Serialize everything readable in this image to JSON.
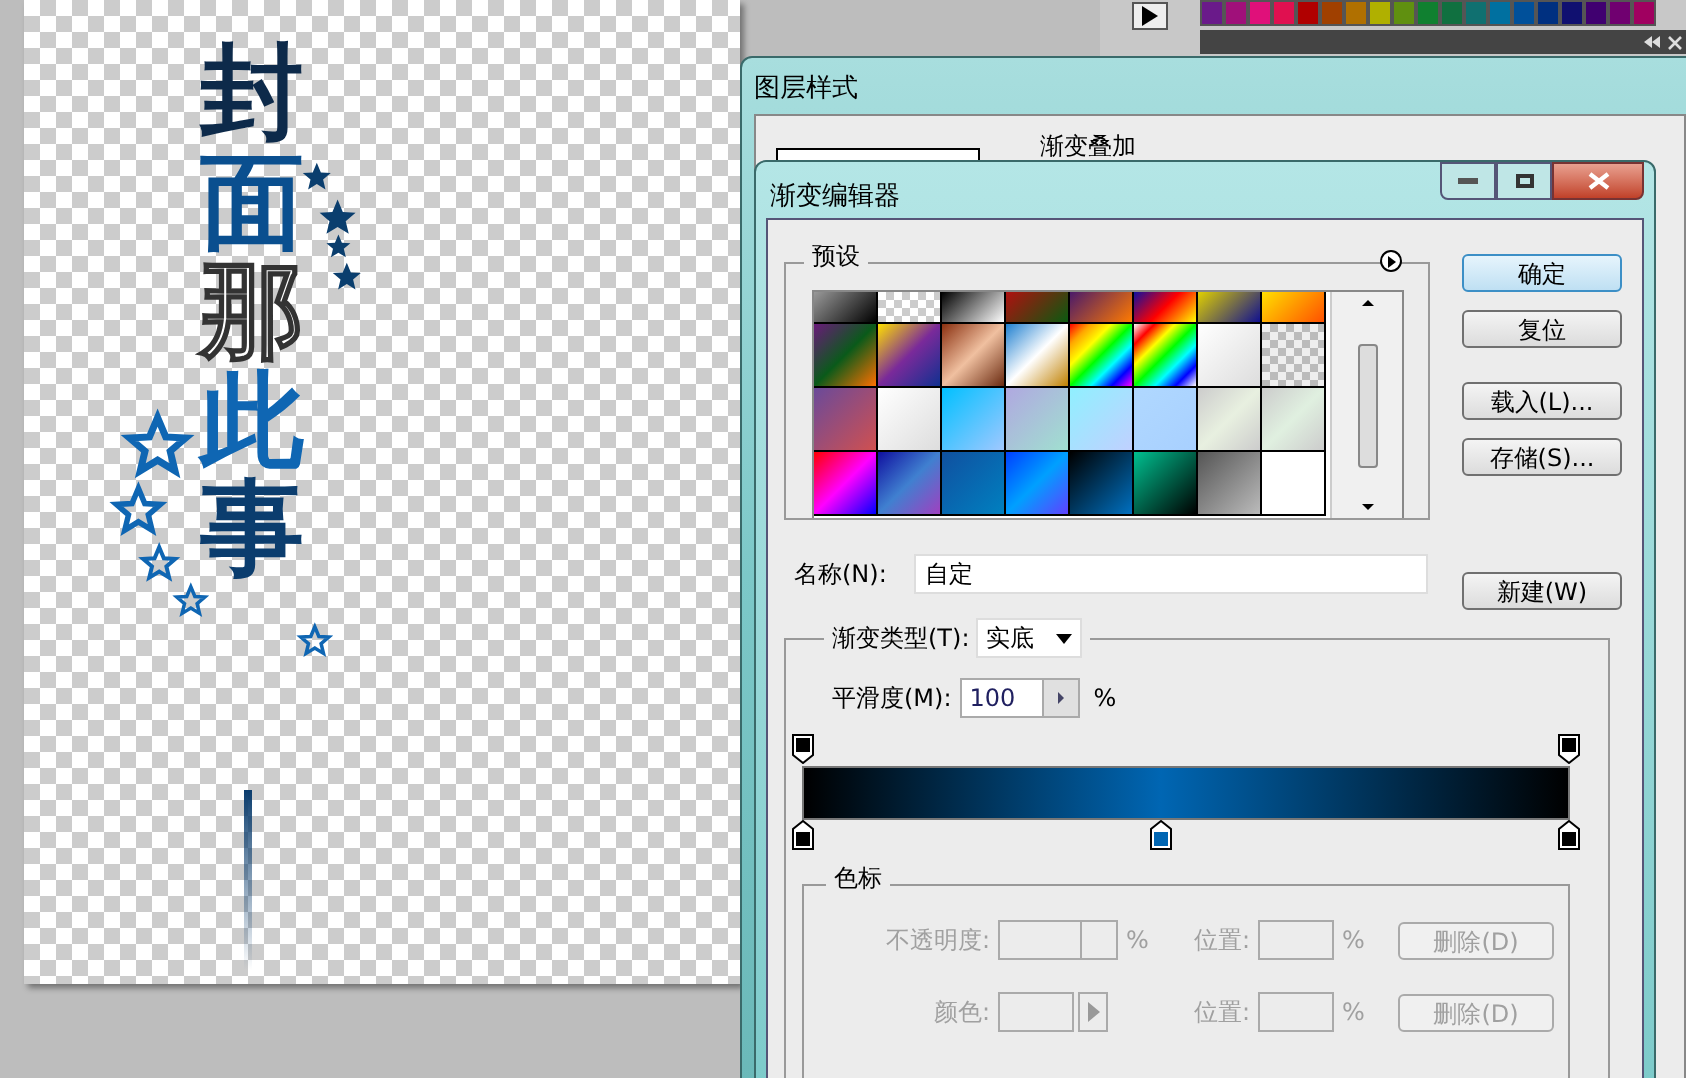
{
  "canvas_art": {
    "characters": [
      {
        "text": "封",
        "kind": "solid",
        "color": "#0d2a4a"
      },
      {
        "text": "面",
        "kind": "solid",
        "color": "#0a4f8f"
      },
      {
        "text": "那",
        "kind": "selection",
        "color": "#ffffff"
      },
      {
        "text": "此",
        "kind": "solid",
        "color": "#0f66b3"
      },
      {
        "text": "事",
        "kind": "solid",
        "color": "#0b3d6e"
      }
    ]
  },
  "layer_style_window": {
    "title": "图层样式",
    "group_label": "渐变叠加"
  },
  "gradient_editor": {
    "title": "渐变编辑器",
    "presets_label": "预设",
    "buttons": [
      {
        "label": "确定",
        "default": true
      },
      {
        "label": "复位",
        "default": false
      },
      {
        "label": "载入(L)...",
        "default": false
      },
      {
        "label": "存储(S)...",
        "default": false
      }
    ],
    "new_button": "新建(W)",
    "name_label": "名称(N):",
    "name_value": "自定",
    "type_label": "渐变类型(T):",
    "type_value": "实底",
    "smoothness_label": "平滑度(M):",
    "smoothness_value": "100",
    "smoothness_unit": "%",
    "opacity_stops": [
      {
        "color": "#000000",
        "level": 0,
        "selected": false
      },
      {
        "color": "#000000",
        "level": 1,
        "selected": false
      }
    ],
    "color_stops": [
      {
        "color": "#000000",
        "level": 0,
        "selected": false
      },
      {
        "color": "#0066b3",
        "level": 0.467,
        "selected": false
      },
      {
        "color": "#000000",
        "level": 1,
        "selected": false
      }
    ],
    "stops_group": {
      "label": "色标",
      "rows": [
        {
          "kind": "opacity",
          "label": "不透明度:",
          "unit": "%",
          "position_label": "位置:",
          "position_unit": "%",
          "delete_label": "删除(D)",
          "disabled": true
        },
        {
          "kind": "color",
          "label": "颜色:",
          "position_label": "位置:",
          "position_unit": "%",
          "delete_label": "删除(D)",
          "disabled": true
        }
      ]
    }
  }
}
